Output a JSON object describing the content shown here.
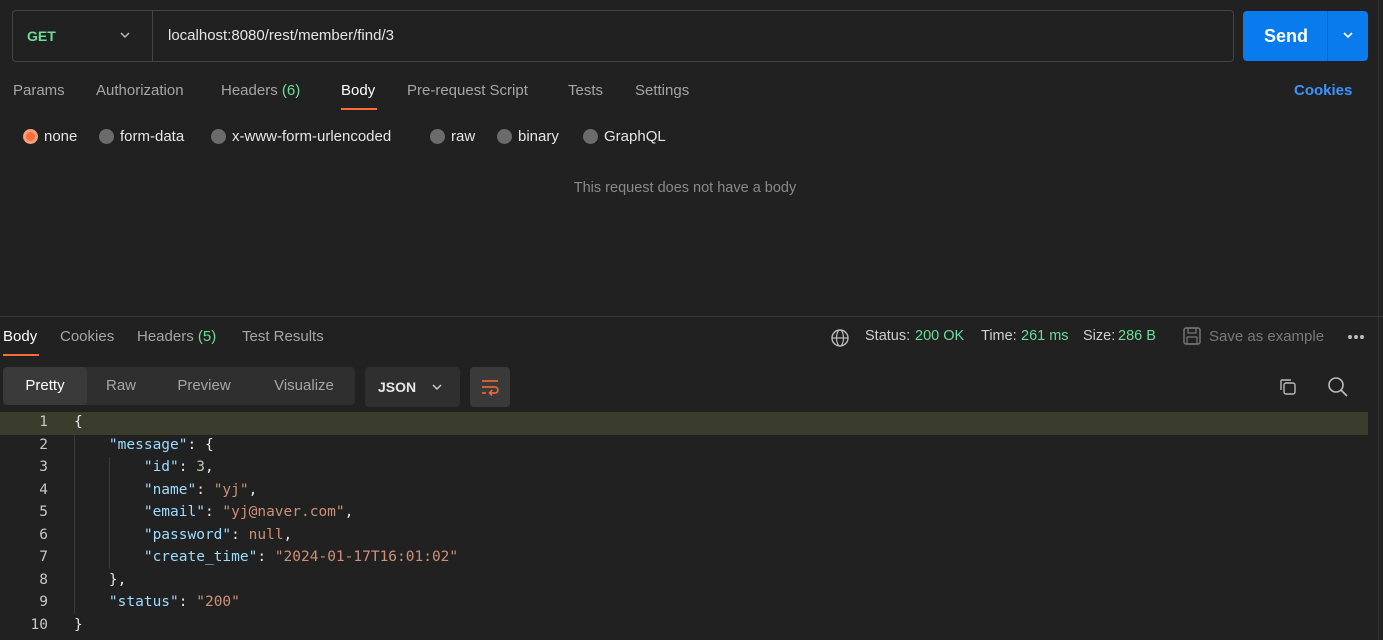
{
  "request": {
    "method": "GET",
    "url": "localhost:8080/rest/member/find/3",
    "send_label": "Send"
  },
  "request_tabs": [
    {
      "label": "Params"
    },
    {
      "label": "Authorization"
    },
    {
      "label": "Headers",
      "count": "(6)"
    },
    {
      "label": "Body"
    },
    {
      "label": "Pre-request Script"
    },
    {
      "label": "Tests"
    },
    {
      "label": "Settings"
    }
  ],
  "cookies_label": "Cookies",
  "body_types": [
    "none",
    "form-data",
    "x-www-form-urlencoded",
    "raw",
    "binary",
    "GraphQL"
  ],
  "no_body_text": "This request does not have a body",
  "response_tabs": [
    {
      "label": "Body"
    },
    {
      "label": "Cookies"
    },
    {
      "label": "Headers",
      "count": "(5)"
    },
    {
      "label": "Test Results"
    }
  ],
  "response_meta": {
    "status_label": "Status:",
    "status_value": "200 OK",
    "time_label": "Time:",
    "time_value": "261 ms",
    "size_label": "Size:",
    "size_value": "286 B"
  },
  "save_example_label": "Save as example",
  "view_modes": [
    "Pretty",
    "Raw",
    "Preview",
    "Visualize"
  ],
  "format": "JSON",
  "code_lines": [
    {
      "n": "1"
    },
    {
      "n": "2"
    },
    {
      "n": "3"
    },
    {
      "n": "4"
    },
    {
      "n": "5"
    },
    {
      "n": "6"
    },
    {
      "n": "7"
    },
    {
      "n": "8"
    },
    {
      "n": "9"
    },
    {
      "n": "10"
    }
  ],
  "response_json": {
    "message_key": "\"message\"",
    "id_key": "\"id\"",
    "id_val": "3",
    "name_key": "\"name\"",
    "name_val": "\"yj\"",
    "email_key": "\"email\"",
    "email_val": "\"yj@naver.com\"",
    "password_key": "\"password\"",
    "password_val": "null",
    "create_time_key": "\"create_time\"",
    "create_time_val": "\"2024-01-17T16:01:02\"",
    "status_key": "\"status\"",
    "status_val": "\"200\""
  },
  "colors": {
    "accent": "#ff6c37",
    "send": "#097bed",
    "success": "#6bdd9a",
    "link": "#3a94ff"
  },
  "icons": [
    "chevron-down-icon",
    "globe-icon",
    "save-icon",
    "more-icon",
    "wrap-icon",
    "copy-icon",
    "search-icon"
  ]
}
